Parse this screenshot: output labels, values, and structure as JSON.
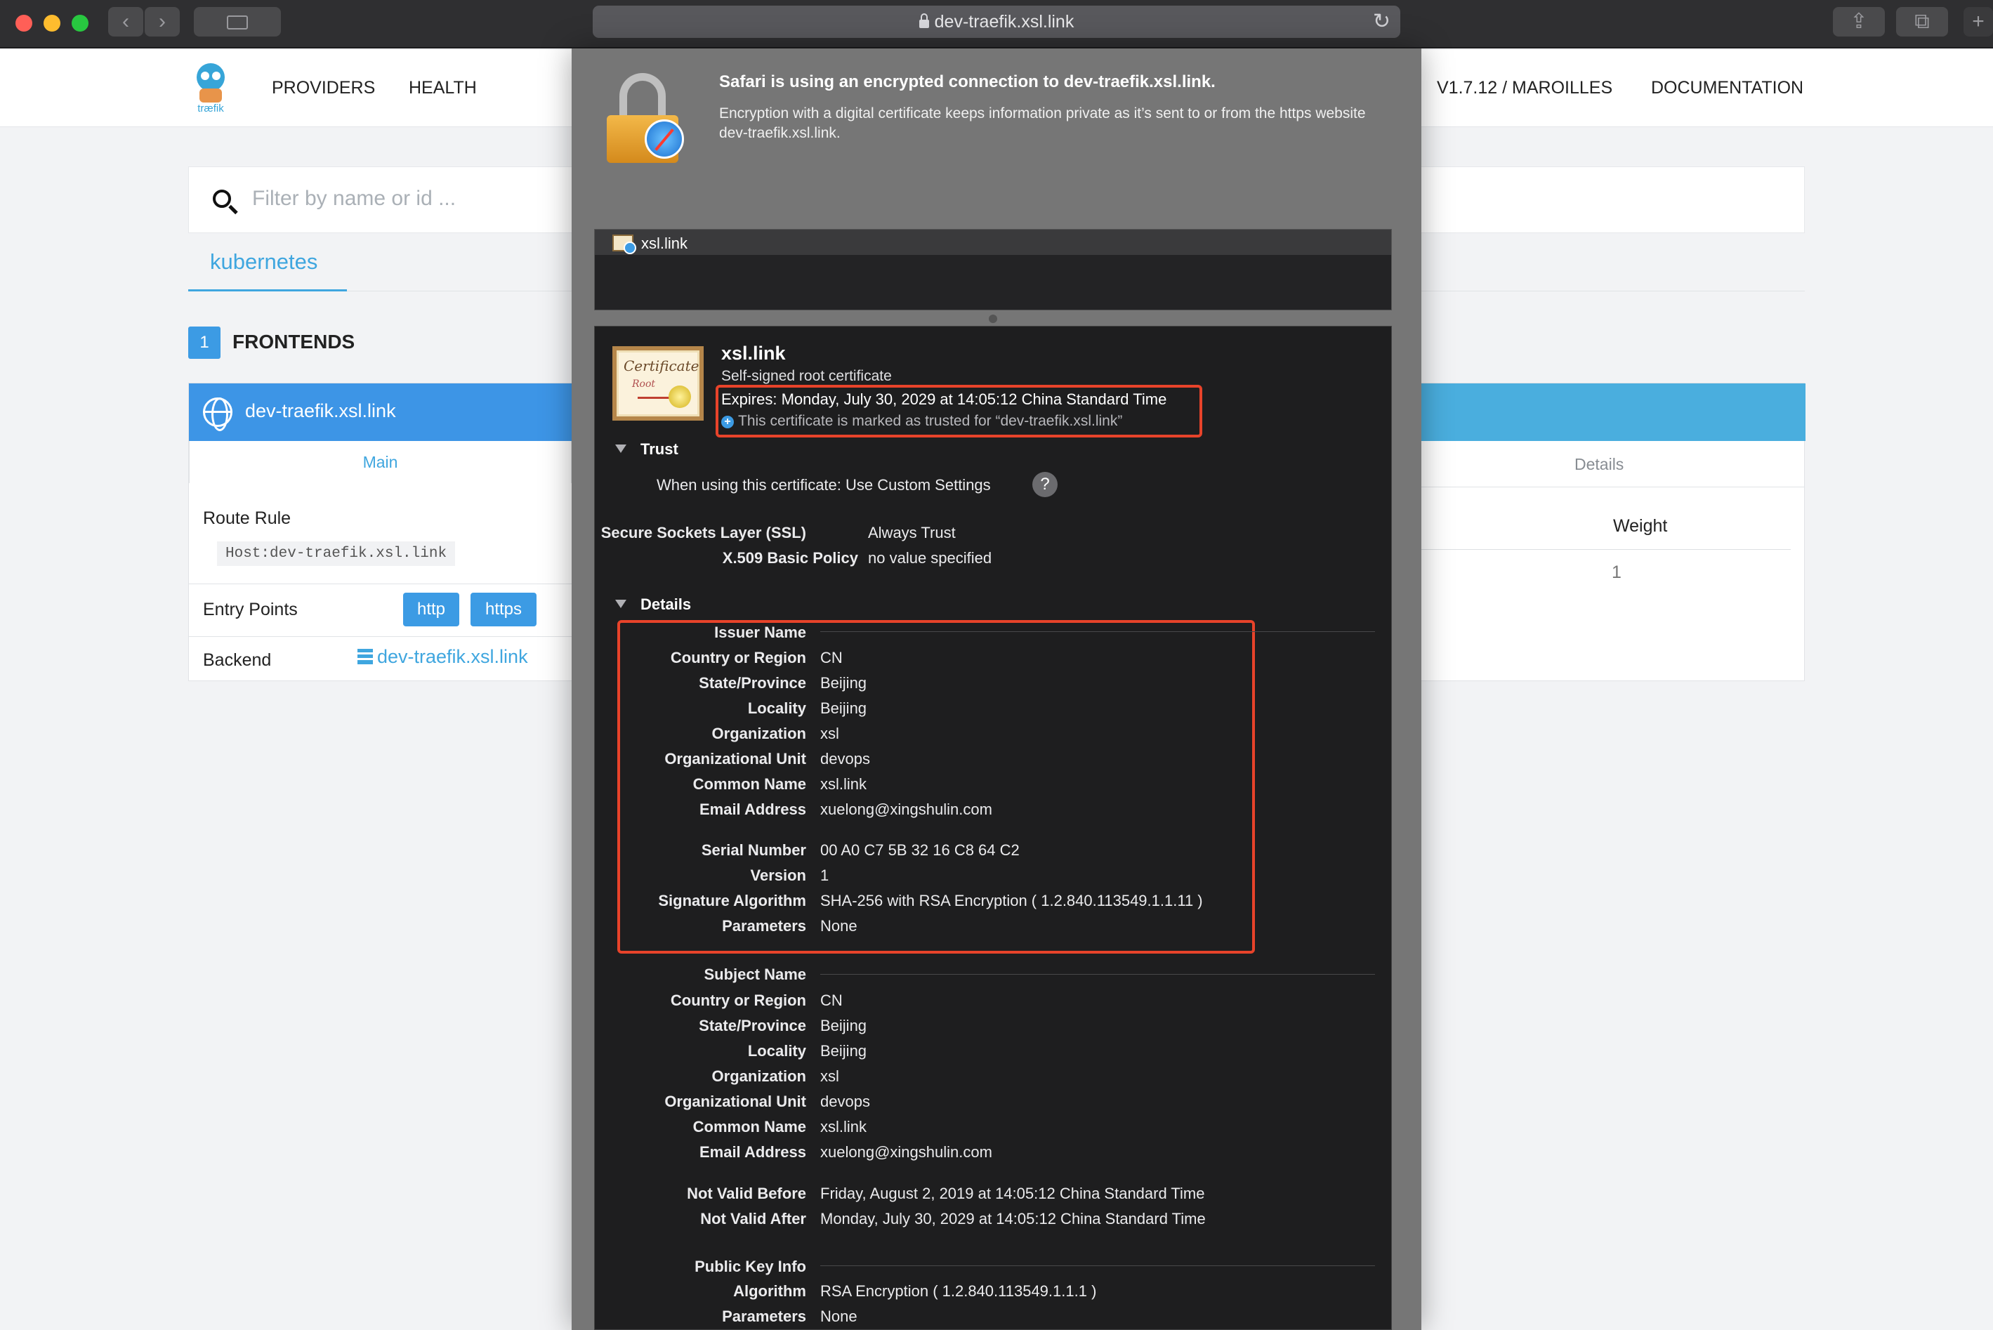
{
  "browser": {
    "url": "dev-traefik.xsl.link"
  },
  "traefik": {
    "logo_text": "træfik",
    "nav": {
      "providers": "PROVIDERS",
      "health": "HEALTH",
      "version": "V1.7.12 / MAROILLES",
      "documentation": "DOCUMENTATION"
    },
    "filter_placeholder": "Filter by name or id ...",
    "provider_tab": "kubernetes",
    "frontends_count": "1",
    "frontends_label": "FRONTENDS",
    "frontend": {
      "name": "dev-traefik.xsl.link",
      "main_tab": "Main",
      "details_tab": "Details",
      "route_rule_label": "Route Rule",
      "route_rule_value": "Host:dev-traefik.xsl.link",
      "entry_points_label": "Entry Points",
      "entry_points": [
        "http",
        "https"
      ],
      "backend_label": "Backend",
      "backend_value": "dev-traefik.xsl.link",
      "weight_label": "Weight",
      "weight_value": "1"
    }
  },
  "sheet": {
    "title": "Safari is using an encrypted connection to dev-traefik.xsl.link.",
    "description": "Encryption with a digital certificate keeps information private as it’s sent to or from the https website dev-traefik.xsl.link.",
    "chain_item": "xsl.link",
    "cert_image_text": "Certificate",
    "cert_image_subtext": "Root",
    "cert": {
      "name": "xsl.link",
      "subtitle": "Self-signed root certificate",
      "expires": "Expires: Monday, July 30, 2029 at 14:05:12 China Standard Time",
      "trusted_note": "This certificate is marked as trusted for “dev-traefik.xsl.link”"
    },
    "trust": {
      "header": "Trust",
      "when_using_label": "When using this certificate:",
      "when_using_value": "Use Custom Settings",
      "help": "?",
      "rows": [
        {
          "label": "Secure Sockets Layer (SSL)",
          "value": "Always Trust"
        },
        {
          "label": "X.509 Basic Policy",
          "value": "no value specified"
        }
      ]
    },
    "details": {
      "header": "Details",
      "issuer_header": "Issuer Name",
      "issuer": [
        {
          "label": "Country or Region",
          "value": "CN"
        },
        {
          "label": "State/Province",
          "value": "Beijing"
        },
        {
          "label": "Locality",
          "value": "Beijing"
        },
        {
          "label": "Organization",
          "value": "xsl"
        },
        {
          "label": "Organizational Unit",
          "value": "devops"
        },
        {
          "label": "Common Name",
          "value": "xsl.link"
        },
        {
          "label": "Email Address",
          "value": "xuelong@xingshulin.com"
        }
      ],
      "cert_info": [
        {
          "label": "Serial Number",
          "value": "00 A0 C7 5B 32 16 C8 64 C2"
        },
        {
          "label": "Version",
          "value": "1"
        },
        {
          "label": "Signature Algorithm",
          "value": "SHA-256 with RSA Encryption ( 1.2.840.113549.1.1.11 )"
        },
        {
          "label": "Parameters",
          "value": "None"
        }
      ],
      "subject_header": "Subject Name",
      "subject": [
        {
          "label": "Country or Region",
          "value": "CN"
        },
        {
          "label": "State/Province",
          "value": "Beijing"
        },
        {
          "label": "Locality",
          "value": "Beijing"
        },
        {
          "label": "Organization",
          "value": "xsl"
        },
        {
          "label": "Organizational Unit",
          "value": "devops"
        },
        {
          "label": "Common Name",
          "value": "xsl.link"
        },
        {
          "label": "Email Address",
          "value": "xuelong@xingshulin.com"
        }
      ],
      "validity": [
        {
          "label": "Not Valid Before",
          "value": "Friday, August 2, 2019 at 14:05:12 China Standard Time"
        },
        {
          "label": "Not Valid After",
          "value": "Monday, July 30, 2029 at 14:05:12 China Standard Time"
        }
      ],
      "pubkey_header": "Public Key Info",
      "pubkey": [
        {
          "label": "Algorithm",
          "value": "RSA Encryption ( 1.2.840.113549.1.1.1 )"
        },
        {
          "label": "Parameters",
          "value": "None"
        }
      ]
    }
  },
  "colors": {
    "accent": "#3c9be4",
    "highlight": "#e8432a"
  }
}
